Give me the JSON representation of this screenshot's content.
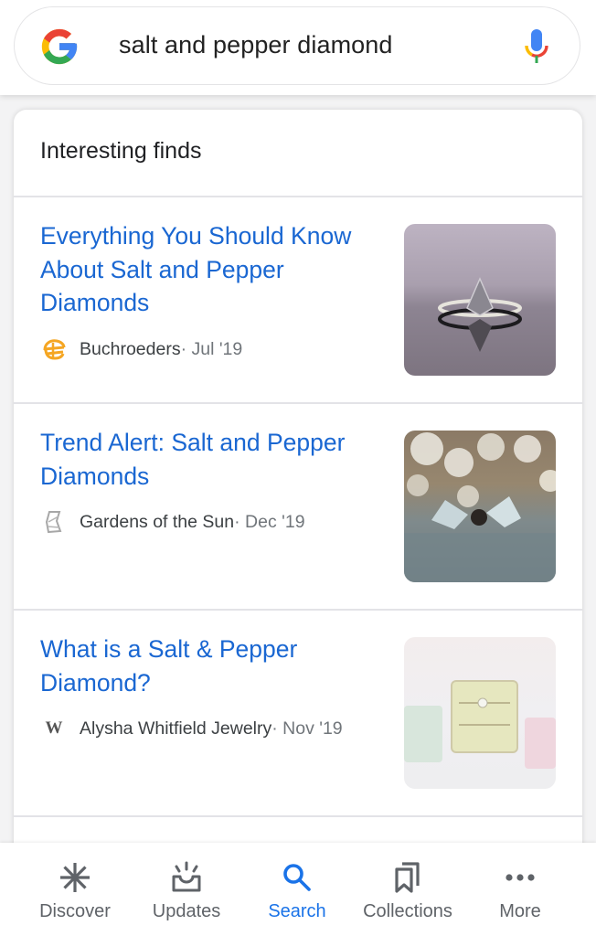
{
  "search": {
    "query": "salt and pepper diamond",
    "logo_icon": "google-g-logo",
    "voice_icon": "microphone-icon"
  },
  "card": {
    "title": "Interesting finds",
    "items": [
      {
        "title": "Everything You Should Know About Salt and Pepper Diamonds",
        "source": "Buchroeders",
        "date": " · Jul '19",
        "favicon": "buchroeders-logo",
        "thumbnail": "pear-shaped salt and pepper diamond ring"
      },
      {
        "title": "Trend Alert: Salt and Pepper Diamonds",
        "source": "Gardens of the Sun",
        "date": " · Dec '19",
        "favicon": "gardens-of-the-sun-logo",
        "thumbnail": "diamond ring with baby's breath flowers"
      },
      {
        "title": "What is a Salt & Pepper Diamond?",
        "source": "Alysha Whitfield Jewelry",
        "date": " · Nov '19",
        "favicon": "alysha-whitfield-w-logo",
        "thumbnail": "rings in pastel ring boxes"
      }
    ]
  },
  "bottom_nav": {
    "items": [
      {
        "label": "Discover",
        "icon": "asterisk-icon",
        "active": false
      },
      {
        "label": "Updates",
        "icon": "inbox-updates-icon",
        "active": false
      },
      {
        "label": "Search",
        "icon": "search-icon",
        "active": true
      },
      {
        "label": "Collections",
        "icon": "bookmarks-icon",
        "active": false
      },
      {
        "label": "More",
        "icon": "more-dots-icon",
        "active": false
      }
    ]
  },
  "colors": {
    "link": "#1a67d2",
    "active_nav": "#1a73e8",
    "inactive_nav": "#5f6368",
    "google_blue": "#4285f4",
    "google_red": "#ea4335",
    "google_yellow": "#fbbc05",
    "google_green": "#34a853"
  }
}
